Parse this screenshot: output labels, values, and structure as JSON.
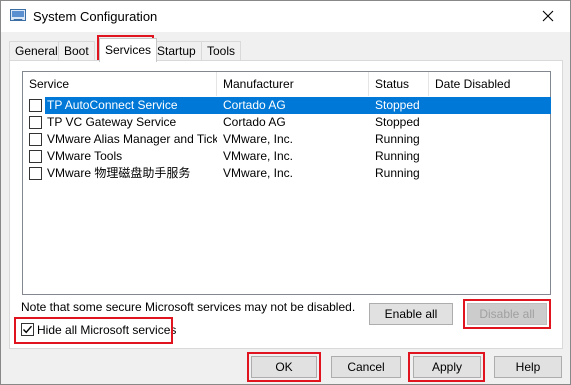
{
  "window": {
    "title": "System Configuration"
  },
  "tabs": [
    {
      "label": "General"
    },
    {
      "label": "Boot"
    },
    {
      "label": "Services"
    },
    {
      "label": "Startup"
    },
    {
      "label": "Tools"
    }
  ],
  "services_table": {
    "columns": [
      "Service",
      "Manufacturer",
      "Status",
      "Date Disabled"
    ],
    "rows": [
      {
        "service": "TP AutoConnect Service",
        "manufacturer": "Cortado AG",
        "status": "Stopped",
        "date_disabled": "",
        "checked": false,
        "selected": true
      },
      {
        "service": "TP VC Gateway Service",
        "manufacturer": "Cortado AG",
        "status": "Stopped",
        "date_disabled": "",
        "checked": false,
        "selected": false
      },
      {
        "service": "VMware Alias Manager and Ticke...",
        "manufacturer": "VMware, Inc.",
        "status": "Running",
        "date_disabled": "",
        "checked": false,
        "selected": false
      },
      {
        "service": "VMware Tools",
        "manufacturer": "VMware, Inc.",
        "status": "Running",
        "date_disabled": "",
        "checked": false,
        "selected": false
      },
      {
        "service": "VMware 物理磁盘助手服务",
        "manufacturer": "VMware, Inc.",
        "status": "Running",
        "date_disabled": "",
        "checked": false,
        "selected": false
      }
    ]
  },
  "note": "Note that some secure Microsoft services may not be disabled.",
  "buttons": {
    "enable_all": "Enable all",
    "disable_all": "Disable all",
    "ok": "OK",
    "cancel": "Cancel",
    "apply": "Apply",
    "help": "Help"
  },
  "hide_ms": {
    "label": "Hide all Microsoft services",
    "checked": true
  },
  "colors": {
    "highlight": "#e0141e",
    "selection": "#0078d7"
  }
}
